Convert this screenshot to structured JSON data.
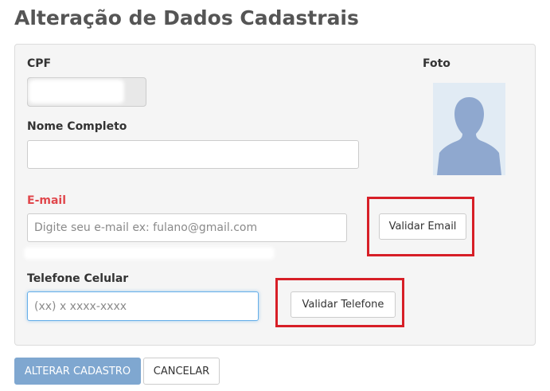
{
  "page": {
    "title": "Alteração de Dados Cadastrais"
  },
  "form": {
    "cpf_label": "CPF",
    "photo_label": "Foto",
    "name_label": "Nome Completo",
    "name_value": "",
    "email_label": "E-mail",
    "email_placeholder": "Digite seu e-mail ex: fulano@gmail.com",
    "validate_email_label": "Validar Email",
    "phone_label": "Telefone Celular",
    "phone_placeholder": "(xx) x xxxx-xxxx",
    "validate_phone_label": "Validar Telefone"
  },
  "actions": {
    "submit_label": "ALTERAR CADASTRO",
    "cancel_label": "CANCELAR"
  },
  "colors": {
    "title": "#555555",
    "error_label": "#e0474c",
    "primary_button": "#7fa7d0",
    "highlight_box": "#d71f27",
    "photo_silhouette": "#8fa8cf",
    "photo_background": "#e1ebf4"
  },
  "icons": {
    "photo": "user-silhouette-icon"
  }
}
